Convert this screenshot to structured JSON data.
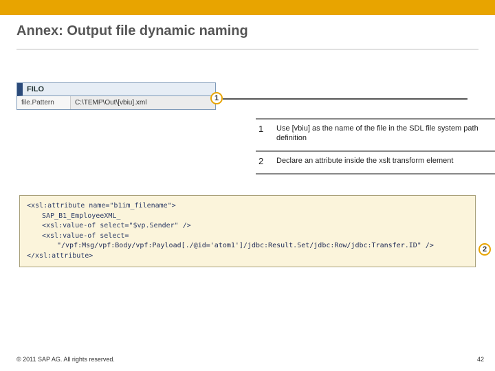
{
  "topbar": {
    "color": "#e8a400"
  },
  "header": {
    "title": "Annex: Output file dynamic naming"
  },
  "filo": {
    "heading": "FILO",
    "field_label": "file.Pattern",
    "field_value": "C:\\TEMP\\Out\\[vbiu].xml"
  },
  "markers": {
    "m1": "1",
    "m2": "2"
  },
  "legend": [
    {
      "num": "1",
      "text": "Use [vbiu] as the name of the file in the SDL file system path definition"
    },
    {
      "num": "2",
      "text": "Declare an attribute inside the xslt transform element"
    }
  ],
  "code": {
    "l1": "<xsl:attribute name=\"b1im_filename\">",
    "l2": "SAP_B1_EmployeeXML_",
    "l3": "<xsl:value-of select=\"$vp.Sender\" />",
    "l4": "<xsl:value-of select=",
    "l5": "\"/vpf:Msg/vpf:Body/vpf:Payload[./@id='atom1']/jdbc:Result.Set/jdbc:Row/jdbc:Transfer.ID\" />",
    "l6": "</xsl:attribute>"
  },
  "footer": {
    "copyright": "© 2011 SAP AG. All rights reserved.",
    "page": "42"
  }
}
